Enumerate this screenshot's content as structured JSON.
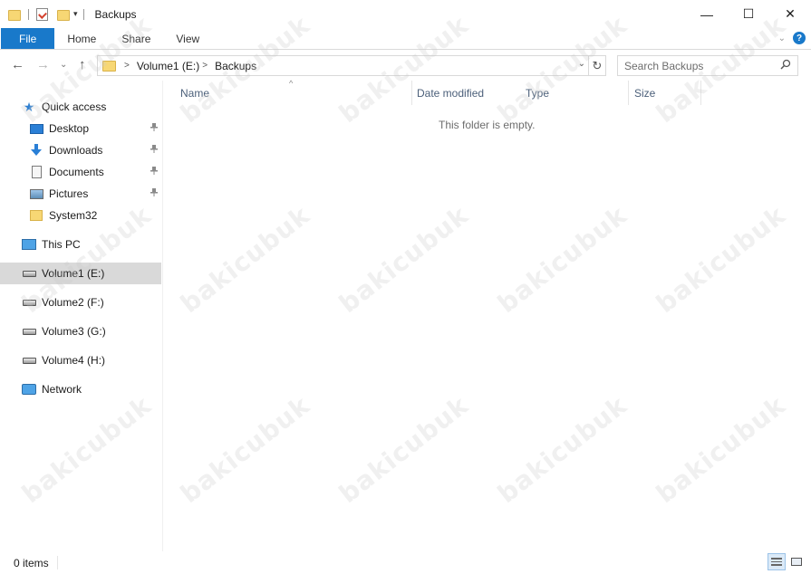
{
  "title_bar": {
    "title": "Backups",
    "qa_dropdown": "▾",
    "minimize": "—",
    "maximize": "☐",
    "close": "✕"
  },
  "ribbon": {
    "tabs": [
      "File",
      "Home",
      "Share",
      "View"
    ],
    "expand": "⌄",
    "help": "?"
  },
  "nav": {
    "back": "←",
    "forward": "→",
    "recent": "⌄",
    "up": "↑"
  },
  "address": {
    "crumbs": [
      "Volume1 (E:)",
      "Backups"
    ],
    "sep": ">",
    "dropdown": "⌄",
    "refresh": "↻"
  },
  "search": {
    "placeholder": "Search Backups",
    "icon": "🔍"
  },
  "navpane": {
    "quick_access": "Quick access",
    "items": [
      {
        "label": "Desktop",
        "icon": "desktop-icon"
      },
      {
        "label": "Downloads",
        "icon": "download-icon"
      },
      {
        "label": "Documents",
        "icon": "documents-icon"
      },
      {
        "label": "Pictures",
        "icon": "pictures-icon"
      },
      {
        "label": "System32",
        "icon": "folder-icon"
      }
    ],
    "pin": "📌",
    "this_pc": "This PC",
    "drives": [
      "Volume1 (E:)",
      "Volume2 (F:)",
      "Volume3 (G:)",
      "Volume4 (H:)"
    ],
    "network": "Network"
  },
  "content": {
    "columns": [
      "Name",
      "Date modified",
      "Type",
      "Size"
    ],
    "sort_arrow": "^",
    "empty_message": "This folder is empty."
  },
  "status": {
    "count": "0 items"
  },
  "watermark": "bakicubuk",
  "colors": {
    "accent": "#1979ca",
    "selected": "#d9d9d9"
  }
}
